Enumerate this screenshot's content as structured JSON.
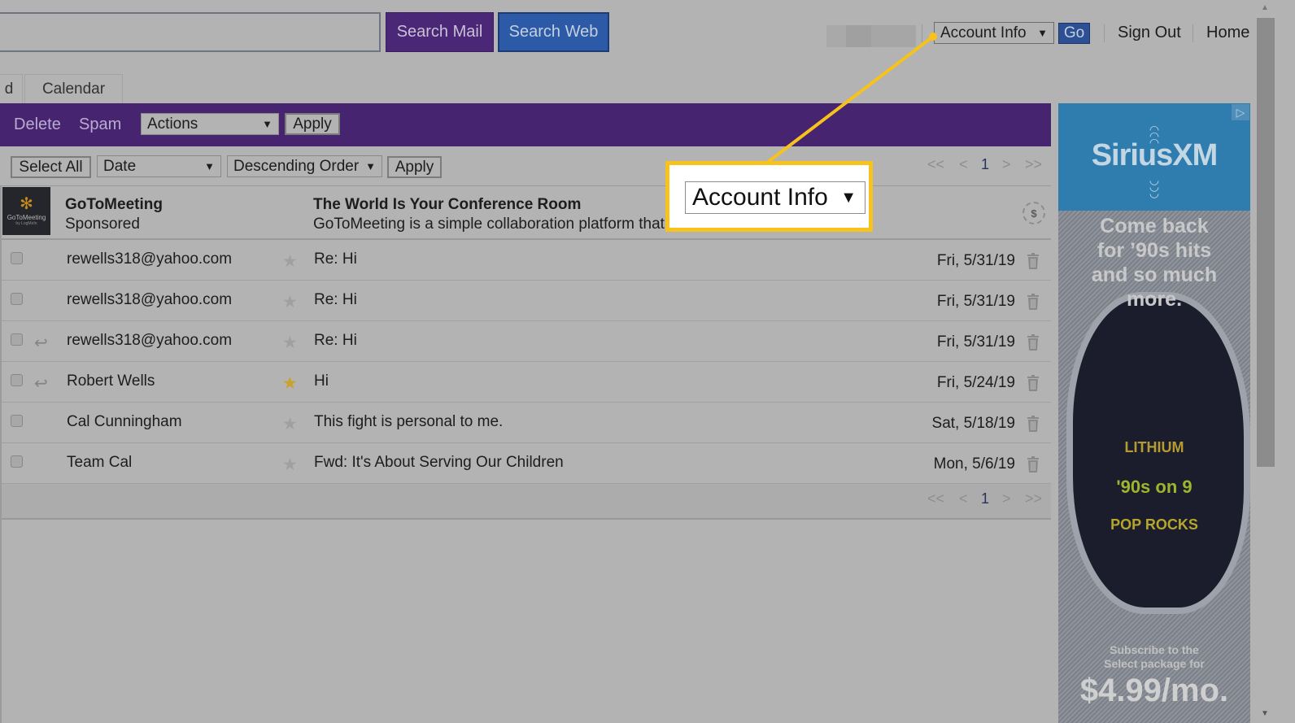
{
  "header": {
    "search_value": "",
    "search_mail_label": "Search Mail",
    "search_web_label": "Search Web",
    "account_select": "Account Info",
    "go_label": "Go",
    "sign_out_label": "Sign Out",
    "home_label": "Home"
  },
  "tabs": [
    {
      "label": "d"
    },
    {
      "label": "Calendar"
    }
  ],
  "toolbar": {
    "delete_label": "Delete",
    "spam_label": "Spam",
    "actions_select": "Actions",
    "apply_label": "Apply"
  },
  "sortbar": {
    "select_all_label": "Select All",
    "sort_field": "Date",
    "sort_order": "Descending Order",
    "apply_label": "Apply"
  },
  "pagination": {
    "first": "<<",
    "prev": "<",
    "current": "1",
    "next": ">",
    "last": ">>"
  },
  "sponsored": {
    "logo_text": "GoToMeeting",
    "logo_sub": "by LogMeIn",
    "sender": "GoToMeeting",
    "tag": "Sponsored",
    "title": "The World Is Your Conference Room",
    "description": "GoToMeeting is a simple collaboration platform that",
    "badge": "$"
  },
  "messages": [
    {
      "sender": "rewells318@yahoo.com",
      "subject": "Re: Hi",
      "date": "Fri, 5/31/19",
      "starred": false,
      "replied": false
    },
    {
      "sender": "rewells318@yahoo.com",
      "subject": "Re: Hi",
      "date": "Fri, 5/31/19",
      "starred": false,
      "replied": false
    },
    {
      "sender": "rewells318@yahoo.com",
      "subject": "Re: Hi",
      "date": "Fri, 5/31/19",
      "starred": false,
      "replied": true
    },
    {
      "sender": "Robert Wells",
      "subject": "Hi",
      "date": "Fri, 5/24/19",
      "starred": true,
      "replied": true
    },
    {
      "sender": "Cal Cunningham",
      "subject": "This fight is personal to me.",
      "date": "Sat, 5/18/19",
      "starred": false,
      "replied": false
    },
    {
      "sender": "Team Cal",
      "subject": "Fwd: It's About Serving Our Children",
      "date": "Mon, 5/6/19",
      "starred": false,
      "replied": false
    }
  ],
  "callout": {
    "label": "Account Info",
    "highlight_color": "#f6c21b"
  },
  "ad": {
    "brand": "SiriusXM",
    "headline": "Come back for '90s hits and so much more.",
    "headline_lines": [
      "Come back",
      "for ’90s hits",
      "and so much",
      "more."
    ],
    "stations": [
      "LITHIUM",
      "'90s on 9",
      "POP ROCKS"
    ],
    "subscribe_lines": [
      "Subscribe to the",
      "Select package for"
    ],
    "price": "$4.99/mo."
  },
  "colors": {
    "purple": "#47246f",
    "blue": "#2d5aa6",
    "star_on": "#c8a22a"
  }
}
